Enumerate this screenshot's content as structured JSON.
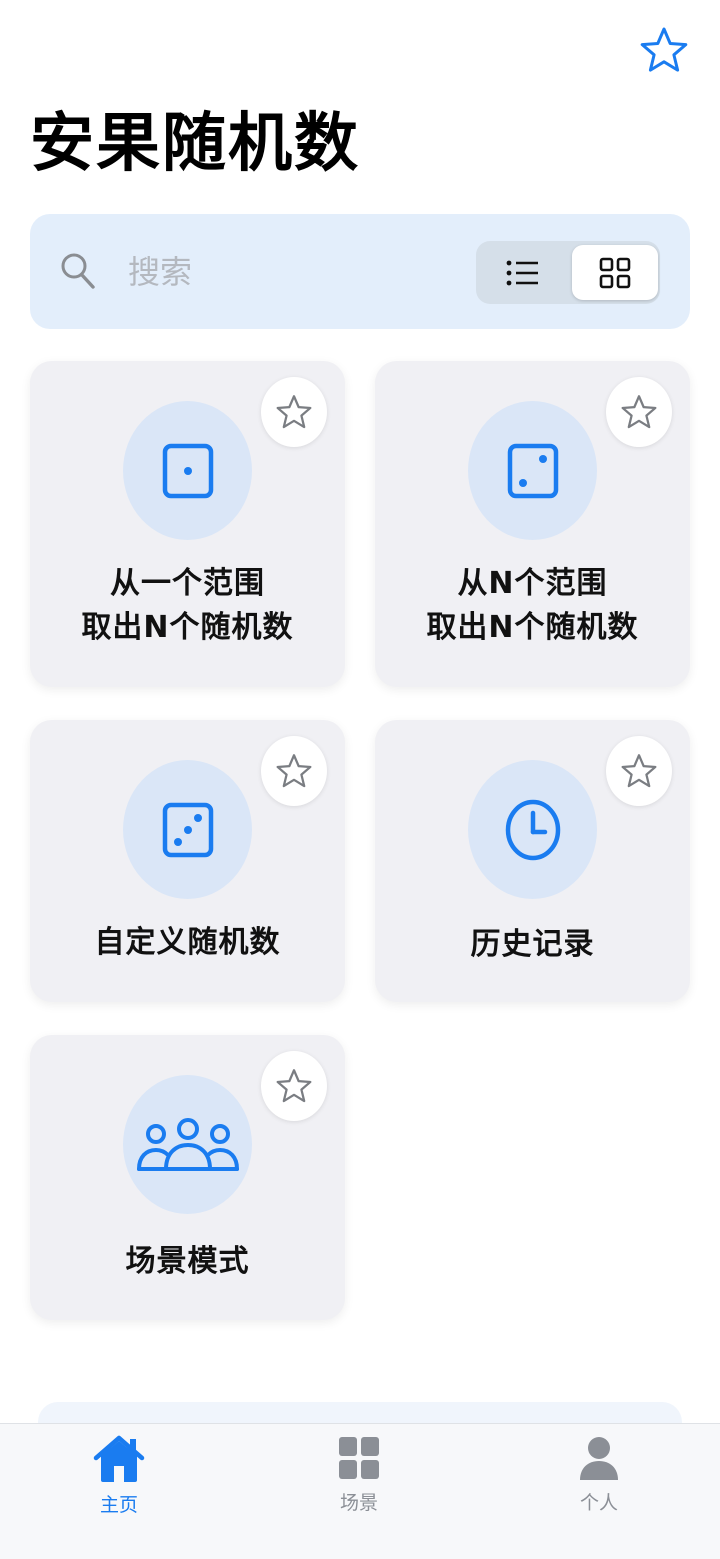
{
  "app": {
    "title": "安果随机数"
  },
  "search": {
    "placeholder": "搜索"
  },
  "view_toggle": {
    "options": [
      "list",
      "grid"
    ],
    "selected": "grid"
  },
  "cards": [
    {
      "label_line1": "从一个范围",
      "label_line2": "取出N个随机数",
      "icon": "dice-one-icon",
      "favorited": false
    },
    {
      "label_line1": "从N个范围",
      "label_line2": "取出N个随机数",
      "icon": "dice-two-icon",
      "favorited": false
    },
    {
      "label": "自定义随机数",
      "icon": "dice-three-icon",
      "favorited": false
    },
    {
      "label": "历史记录",
      "icon": "clock-icon",
      "favorited": false
    },
    {
      "label": "场景模式",
      "icon": "people-icon",
      "favorited": false
    }
  ],
  "tabbar": {
    "items": [
      {
        "label": "主页",
        "icon": "home-icon",
        "active": true
      },
      {
        "label": "场景",
        "icon": "grid-icon",
        "active": false
      },
      {
        "label": "个人",
        "icon": "person-icon",
        "active": false
      }
    ]
  },
  "colors": {
    "accent": "#1a7cf0",
    "search_bg": "#e3eefb",
    "card_bg": "#f0f0f4",
    "icon_circle_bg": "#dae6f7",
    "inactive": "#8b8f96"
  }
}
